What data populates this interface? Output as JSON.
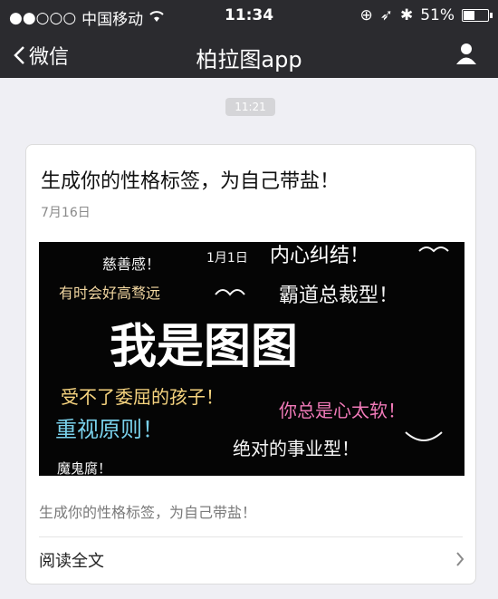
{
  "status_bar": {
    "carrier": "中国移动",
    "time": "11:34",
    "battery_percent": "51%",
    "battery_level": 0.51
  },
  "nav": {
    "back_label": "微信",
    "title": "柏拉图app"
  },
  "chat": {
    "timestamp": "11:21"
  },
  "article": {
    "title": "生成你的性格标签，为自己带盐！",
    "date": "7月16日",
    "summary": "生成你的性格标签，为自己带盐！",
    "read_more": "阅读全文",
    "cover_labels": {
      "big": "我是图图",
      "tag1": "慈善感！",
      "tag2": "1月1日",
      "tag3": "内心纠结！",
      "tag4": "有时会好高骛远",
      "tag5": "霸道总裁型！",
      "tag6": "受不了委屈的孩子！",
      "tag7": "你总是心太软！",
      "tag8": "重视原则！",
      "tag9": "绝对的事业型！",
      "tag10": "魔鬼腐！"
    }
  }
}
